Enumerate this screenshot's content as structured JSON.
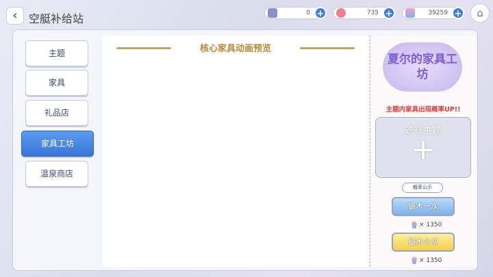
{
  "header": {
    "title": "空艇补给站",
    "back_icon": "chevron-left-icon",
    "home_icon": "home-icon"
  },
  "currencies": [
    {
      "name": "ticket",
      "value": "0"
    },
    {
      "name": "coin",
      "value": "735"
    },
    {
      "name": "gem",
      "value": "39259"
    }
  ],
  "menu": [
    {
      "label": "主题"
    },
    {
      "label": "家具"
    },
    {
      "label": "礼品店"
    },
    {
      "label": "家具工坊",
      "selected": true
    },
    {
      "label": "温泉商店"
    }
  ],
  "center": {
    "title": "核心家具动画预览"
  },
  "right": {
    "logo": "夏尔的家具工坊",
    "notice": "主题内家具出现概率UP!!",
    "select_theme": "选择主题",
    "plus": "+",
    "probability": "概率公示",
    "buttons": [
      {
        "label": "锯木一次",
        "cost": "1350",
        "color": "#8fc0f0"
      },
      {
        "label": "锯木十次",
        "cost": "1350",
        "color": "#f5d860"
      }
    ],
    "times": "×"
  }
}
